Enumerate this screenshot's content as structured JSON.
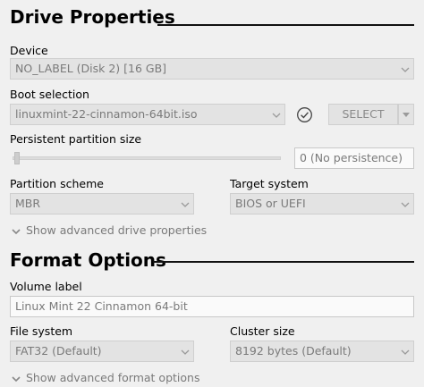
{
  "drive_properties": {
    "title": "Drive Properties",
    "device": {
      "label": "Device",
      "value": "NO_LABEL (Disk 2) [16 GB]"
    },
    "boot_selection": {
      "label": "Boot selection",
      "value": "linuxmint-22-cinnamon-64bit.iso",
      "select_label": "SELECT"
    },
    "persistent": {
      "label": "Persistent partition size",
      "value": "0 (No persistence)",
      "level": 0
    },
    "partition_scheme": {
      "label": "Partition scheme",
      "value": "MBR"
    },
    "target_system": {
      "label": "Target system",
      "value": "BIOS or UEFI"
    },
    "advanced_label": "Show advanced drive properties"
  },
  "format_options": {
    "title": "Format Options",
    "volume_label": {
      "label": "Volume label",
      "value": "Linux Mint 22 Cinnamon 64-bit"
    },
    "file_system": {
      "label": "File system",
      "value": "FAT32 (Default)"
    },
    "cluster_size": {
      "label": "Cluster size",
      "value": "8192 bytes (Default)"
    },
    "advanced_label": "Show advanced format options"
  },
  "icons": {
    "dropdown": "chevron-down-icon",
    "check": "check-circle-icon",
    "expander": "chevron-down-icon"
  },
  "colors": {
    "background": "#f0f0f0",
    "disabled_field": "#e3e3e3",
    "disabled_text": "#7a7a7a"
  }
}
